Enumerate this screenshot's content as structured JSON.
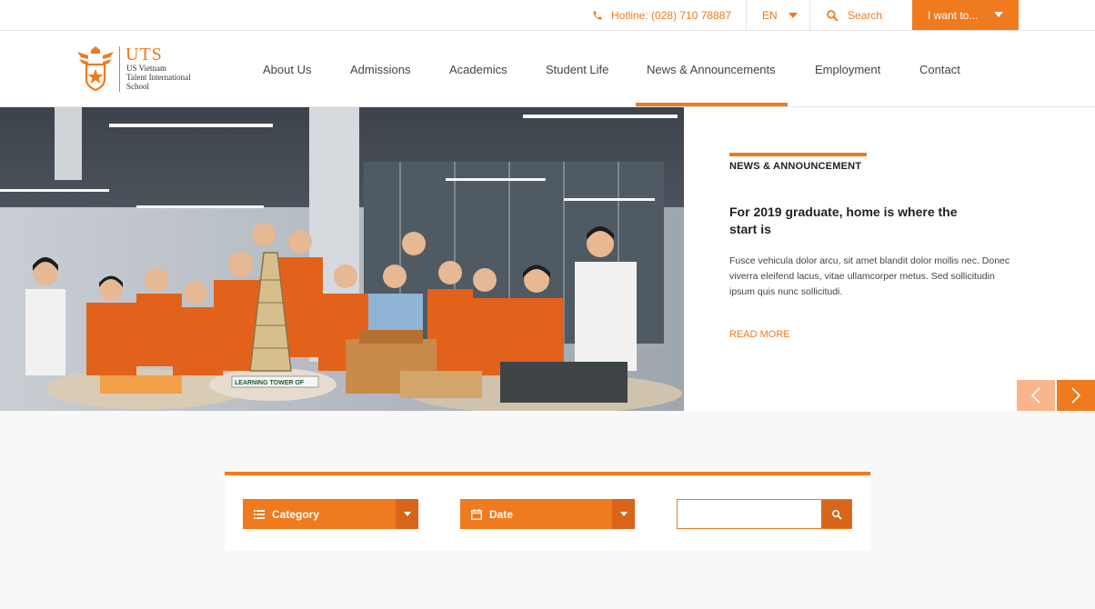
{
  "topbar": {
    "hotline": "Hotline: (028) 710 78887",
    "language": "EN",
    "search_label": "Search",
    "iwant_label": "I want to..."
  },
  "logo": {
    "brand": "UTS",
    "line1": "US Vietnam",
    "line2": "Talent International",
    "line3": "School"
  },
  "nav": {
    "items": [
      {
        "label": "About Us"
      },
      {
        "label": "Admissions"
      },
      {
        "label": "Academics"
      },
      {
        "label": "Student Life"
      },
      {
        "label": "News & Announcements"
      },
      {
        "label": "Employment"
      },
      {
        "label": "Contact"
      }
    ],
    "active": "News & Announcements"
  },
  "hero": {
    "tag": "NEWS & ANNOUNCEMENT",
    "title": "For 2019 graduate, home is where the start is",
    "body": "Fusce vehicula dolor arcu, sit amet blandit dolor mollis nec. Donec viverra eleifend lacus, vitae ullamcorper metus. Sed sollicitudin ipsum quis nunc sollicitudi.",
    "read_more": "READ MORE",
    "photo_sign": "LEARNING TOWER OF"
  },
  "filter": {
    "category_label": "Category",
    "date_label": "Date",
    "search_value": ""
  },
  "colors": {
    "accent": "#f07a1e",
    "accent_dark": "#d8651a",
    "accent_light": "#f9b58b"
  }
}
